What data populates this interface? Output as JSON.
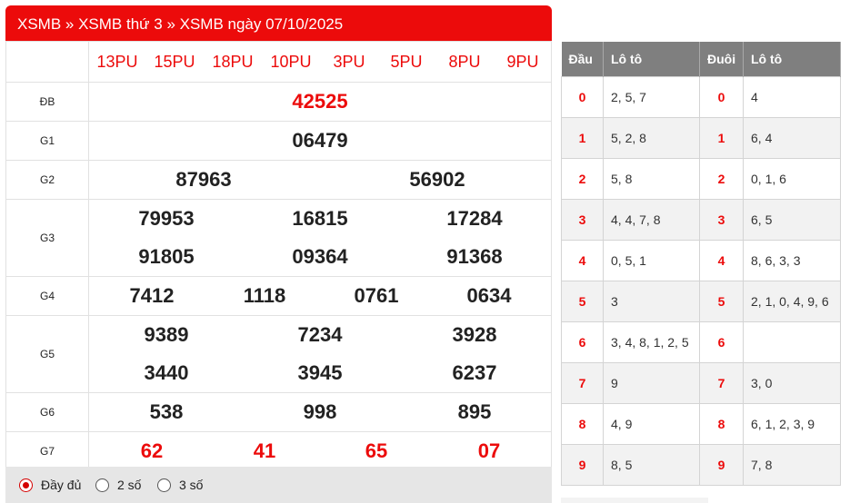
{
  "header": {
    "breadcrumb": "XSMB » XSMB thứ 3 » XSMB ngày 07/10/2025"
  },
  "codes": [
    "13PU",
    "15PU",
    "18PU",
    "10PU",
    "3PU",
    "5PU",
    "8PU",
    "9PU"
  ],
  "prizes": [
    {
      "label": "ĐB",
      "numbers": [
        "42525"
      ]
    },
    {
      "label": "G1",
      "numbers": [
        "06479"
      ]
    },
    {
      "label": "G2",
      "numbers": [
        "87963",
        "56902"
      ]
    },
    {
      "label": "G3",
      "numbers": [
        "79953",
        "16815",
        "17284",
        "91805",
        "09364",
        "91368"
      ]
    },
    {
      "label": "G4",
      "numbers": [
        "7412",
        "1118",
        "0761",
        "0634"
      ]
    },
    {
      "label": "G5",
      "numbers": [
        "9389",
        "7234",
        "3928",
        "3440",
        "3945",
        "6237"
      ]
    },
    {
      "label": "G6",
      "numbers": [
        "538",
        "998",
        "895"
      ]
    },
    {
      "label": "G7",
      "numbers": [
        "62",
        "41",
        "65",
        "07"
      ]
    }
  ],
  "options": [
    {
      "label": "Đầy đủ",
      "checked": true
    },
    {
      "label": "2 số",
      "checked": false
    },
    {
      "label": "3 số",
      "checked": false
    }
  ],
  "loto": {
    "headers": [
      "Đầu",
      "Lô tô",
      "Đuôi",
      "Lô tô"
    ],
    "rows": [
      {
        "dau": "0",
        "dau_vals": "2, 5, 7",
        "duoi": "0",
        "duoi_vals": "4"
      },
      {
        "dau": "1",
        "dau_vals": "5, 2, 8",
        "duoi": "1",
        "duoi_vals": "6, 4"
      },
      {
        "dau": "2",
        "dau_vals": "5, 8",
        "duoi": "2",
        "duoi_vals": "0, 1, 6"
      },
      {
        "dau": "3",
        "dau_vals": "4, 4, 7, 8",
        "duoi": "3",
        "duoi_vals": "6, 5"
      },
      {
        "dau": "4",
        "dau_vals": "0, 5, 1",
        "duoi": "4",
        "duoi_vals": "8, 6, 3, 3"
      },
      {
        "dau": "5",
        "dau_vals": "3",
        "duoi": "5",
        "duoi_vals": "2, 1, 0, 4, 9, 6"
      },
      {
        "dau": "6",
        "dau_vals": "3, 4, 8, 1, 2, 5",
        "duoi": "6",
        "duoi_vals": ""
      },
      {
        "dau": "7",
        "dau_vals": "9",
        "duoi": "7",
        "duoi_vals": "3, 0"
      },
      {
        "dau": "8",
        "dau_vals": "4, 9",
        "duoi": "8",
        "duoi_vals": "6, 1, 2, 3, 9"
      },
      {
        "dau": "9",
        "dau_vals": "8, 5",
        "duoi": "9",
        "duoi_vals": "7, 8"
      }
    ]
  },
  "colors": {
    "accent": "#ec0b0b",
    "header_bg": "#7f7f7f",
    "footer_bg": "#e6e6e6"
  }
}
